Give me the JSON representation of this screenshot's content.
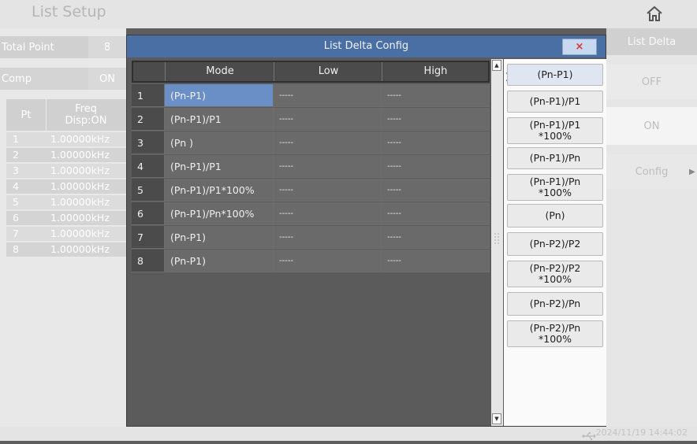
{
  "header": {
    "title": "List Setup",
    "home_icon": "home-icon"
  },
  "left_panel": {
    "total_point_label": "Total Point",
    "total_point_value": "8",
    "comp_label": "Comp",
    "comp_value": "ON",
    "pt_header": "Pt",
    "freq_header_line1": "Freq",
    "freq_header_line2": "Disp:ON",
    "rows": [
      {
        "n": "1",
        "v": "1.00000kHz"
      },
      {
        "n": "2",
        "v": "1.00000kHz"
      },
      {
        "n": "3",
        "v": "1.00000kHz"
      },
      {
        "n": "4",
        "v": "1.00000kHz"
      },
      {
        "n": "5",
        "v": "1.00000kHz"
      },
      {
        "n": "6",
        "v": "1.00000kHz"
      },
      {
        "n": "7",
        "v": "1.00000kHz"
      },
      {
        "n": "8",
        "v": "1.00000kHz"
      }
    ]
  },
  "right_panel": {
    "title": "List Delta",
    "off_label": "OFF",
    "on_label": "ON",
    "config_label": "Config",
    "config_arrow": "▶"
  },
  "dialog": {
    "title": "List Delta Config",
    "close_label": "×",
    "columns": [
      "Mode",
      "Low",
      "High"
    ],
    "rows": [
      {
        "idx": "1",
        "mode": "(Pn-P1)",
        "low": "-----",
        "high": "-----"
      },
      {
        "idx": "2",
        "mode": "(Pn-P1)/P1",
        "low": "-----",
        "high": "-----"
      },
      {
        "idx": "3",
        "mode": "(Pn    )",
        "low": "-----",
        "high": "-----"
      },
      {
        "idx": "4",
        "mode": "(Pn-P1)/P1",
        "low": "-----",
        "high": "-----"
      },
      {
        "idx": "5",
        "mode": "(Pn-P1)/P1*100%",
        "low": "-----",
        "high": "-----"
      },
      {
        "idx": "6",
        "mode": "(Pn-P1)/Pn*100%",
        "low": "-----",
        "high": "-----"
      },
      {
        "idx": "7",
        "mode": "(Pn-P1)",
        "low": "-----",
        "high": "-----"
      },
      {
        "idx": "8",
        "mode": "(Pn-P1)",
        "low": "-----",
        "high": "-----"
      }
    ],
    "options": [
      {
        "l1": "(Pn-P1)",
        "l2": ""
      },
      {
        "l1": "(Pn-P1)/P1",
        "l2": ""
      },
      {
        "l1": "(Pn-P1)/P1",
        "l2": "*100%"
      },
      {
        "l1": "(Pn-P1)/Pn",
        "l2": ""
      },
      {
        "l1": "(Pn-P1)/Pn",
        "l2": "*100%"
      },
      {
        "l1": "(Pn)",
        "l2": ""
      },
      {
        "l1": "(Pn-P2)/P2",
        "l2": ""
      },
      {
        "l1": "(Pn-P2)/P2",
        "l2": "*100%"
      },
      {
        "l1": "(Pn-P2)/Pn",
        "l2": ""
      },
      {
        "l1": "(Pn-P2)/Pn",
        "l2": "*100%"
      }
    ],
    "selected_marker": "〉"
  },
  "status_bar": {
    "timestamp": "2024/11/19 14:44:02",
    "usb_icon": "usb-icon"
  },
  "colors": {
    "dialog_title_bg": "#4a6fa5",
    "selected_cell": "#6a8fc6",
    "close_x": "#d8342b"
  }
}
